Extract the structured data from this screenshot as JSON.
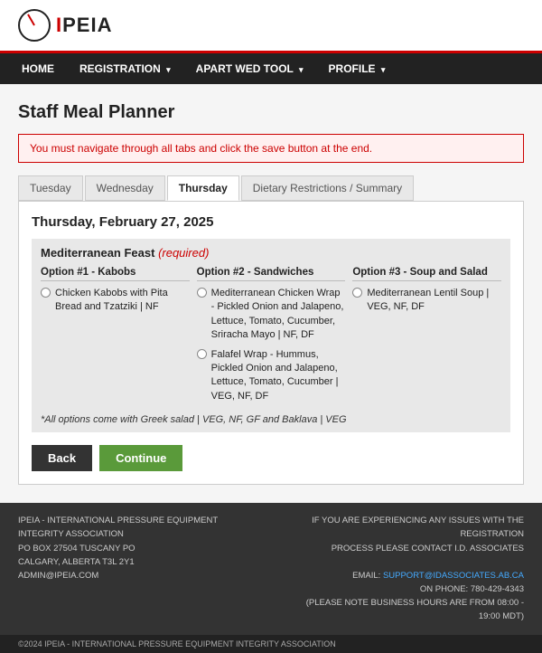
{
  "logo": {
    "text": "IPEIA"
  },
  "nav": {
    "items": [
      {
        "label": "HOME",
        "caret": false
      },
      {
        "label": "REGISTRATION",
        "caret": true
      },
      {
        "label": "APART WED TOOL",
        "caret": true
      },
      {
        "label": "PROFILE",
        "caret": true
      }
    ]
  },
  "page": {
    "title": "Staff Meal Planner",
    "alert": "You must navigate through all tabs and click the save button at the end."
  },
  "tabs": [
    {
      "label": "Tuesday",
      "active": false
    },
    {
      "label": "Wednesday",
      "active": false
    },
    {
      "label": "Thursday",
      "active": true
    },
    {
      "label": "Dietary Restrictions / Summary",
      "active": false
    }
  ],
  "panel": {
    "date": "Thursday, February 27, 2025",
    "meal": {
      "title": "Mediterranean Feast",
      "required": "(required)",
      "options": [
        {
          "header": "Option #1 - Kabobs",
          "items": [
            {
              "text": "Chicken Kabobs with Pita Bread and Tzatziki | NF"
            }
          ]
        },
        {
          "header": "Option #2 - Sandwiches",
          "items": [
            {
              "text": "Mediterranean Chicken Wrap - Pickled Onion and Jalapeno, Lettuce, Tomato, Cucumber, Sriracha Mayo | NF, DF"
            },
            {
              "text": "Falafel Wrap - Hummus, Pickled Onion and Jalapeno, Lettuce, Tomato, Cucumber | VEG, NF, DF"
            }
          ]
        },
        {
          "header": "Option #3 - Soup and Salad",
          "items": [
            {
              "text": "Mediterranean Lentil Soup | VEG, NF, DF"
            }
          ]
        }
      ],
      "footnote": "*All options come with Greek salad | VEG, NF, GF and Baklava | VEG"
    }
  },
  "buttons": {
    "back": "Back",
    "continue": "Continue"
  },
  "footer": {
    "left_lines": [
      "IPEIA - INTERNATIONAL PRESSURE EQUIPMENT INTEGRITY ASSOCIATION",
      "PO BOX 27504 TUSCANY PO",
      "CALGARY, ALBERTA T3L 2Y1",
      "ADMIN@IPEIA.COM"
    ],
    "right_lines": [
      "IF YOU ARE EXPERIENCING ANY ISSUES WITH THE REGISTRATION",
      "PROCESS PLEASE CONTACT I.D. ASSOCIATES",
      "",
      "EMAIL: SUPPORT@IDASSOCIATES.AB.CA",
      "ON PHONE: 780-429-4343",
      "(PLEASE NOTE BUSINESS HOURS ARE FROM 08:00 - 19:00 MDT)"
    ],
    "copyright": "©2024 IPEIA - INTERNATIONAL PRESSURE EQUIPMENT INTEGRITY ASSOCIATION"
  }
}
